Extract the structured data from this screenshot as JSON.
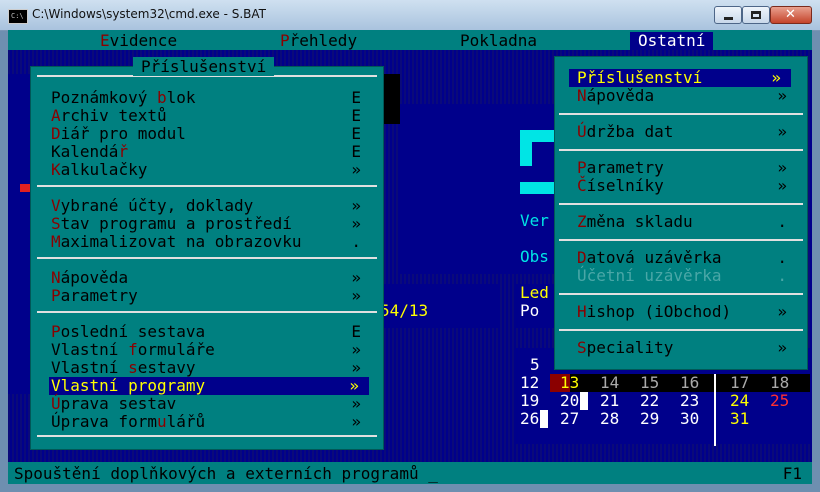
{
  "window": {
    "title": "C:\\Windows\\system32\\cmd.exe - S.BAT",
    "icon_text": "C:\\",
    "icon": "console-icon"
  },
  "menubar": {
    "items": [
      {
        "label": "Evidence",
        "hotkey": "E",
        "rest": "vidence"
      },
      {
        "label": "Přehledy",
        "hotkey": "P",
        "rest": "řehledy"
      },
      {
        "label": "Pokladna",
        "hotkey": "",
        "rest": "Pokladna"
      },
      {
        "label": "Ostatní",
        "hotkey": "",
        "rest": "Ostatní"
      }
    ]
  },
  "main_menu": {
    "title": "Příslušenství",
    "items": [
      {
        "pre": "Poznámkový ",
        "hk": "b",
        "post": "lok",
        "shortcut": "E"
      },
      {
        "pre": "",
        "hk": "A",
        "post": "rchiv textů",
        "shortcut": "E"
      },
      {
        "pre": "",
        "hk": "D",
        "post": "iář pro modul",
        "shortcut": "E"
      },
      {
        "pre": "Kalendá",
        "hk": "ř",
        "post": "",
        "shortcut": "E"
      },
      {
        "pre": "",
        "hk": "K",
        "post": "alkulačky",
        "shortcut": "»"
      },
      {
        "pre": "",
        "hk": "V",
        "post": "ybrané účty, doklady",
        "shortcut": "»"
      },
      {
        "pre": "",
        "hk": "S",
        "post": "tav programu a prostředí",
        "shortcut": "»"
      },
      {
        "pre": "",
        "hk": "M",
        "post": "aximalizovat na obrazovku",
        "shortcut": "."
      },
      {
        "pre": "",
        "hk": "N",
        "post": "ápověda",
        "shortcut": "»"
      },
      {
        "pre": "",
        "hk": "P",
        "post": "arametry",
        "shortcut": "»"
      },
      {
        "pre": "",
        "hk": "P",
        "post": "oslední sestava",
        "shortcut": "E"
      },
      {
        "pre": "Vlastní ",
        "hk": "f",
        "post": "ormuláře",
        "shortcut": "»"
      },
      {
        "pre": "Vlastní ",
        "hk": "s",
        "post": "estavy",
        "shortcut": "»"
      },
      {
        "pre": "",
        "hk": "V",
        "post": "lastní programy",
        "shortcut": "»"
      },
      {
        "pre": "",
        "hk": "Ú",
        "post": "prava sestav",
        "shortcut": "»"
      },
      {
        "pre": "Úprava form",
        "hk": "u",
        "post": "lářů",
        "shortcut": "»"
      }
    ]
  },
  "right_menu": {
    "items": [
      {
        "pre": "",
        "hk": "P",
        "post": "říslušenství",
        "shortcut": "»"
      },
      {
        "pre": "",
        "hk": "N",
        "post": "ápověda",
        "shortcut": "»"
      },
      {
        "pre": "",
        "hk": "Ú",
        "post": "držba dat",
        "shortcut": "»"
      },
      {
        "pre": "",
        "hk": "P",
        "post": "arametry",
        "shortcut": "»"
      },
      {
        "pre": "",
        "hk": "Č",
        "post": "íselníky",
        "shortcut": "»"
      },
      {
        "pre": "",
        "hk": "Z",
        "post": "měna skladu",
        "shortcut": "."
      },
      {
        "pre": "",
        "hk": "D",
        "post": "atová uzávěrka",
        "shortcut": "."
      },
      {
        "pre": "Účetní uzávěrka",
        "hk": "",
        "post": "",
        "shortcut": "."
      },
      {
        "pre": "",
        "hk": "H",
        "post": "ishop (iObchod)",
        "shortcut": "»"
      },
      {
        "pre": "",
        "hk": "S",
        "post": "peciality",
        "shortcut": "»"
      }
    ]
  },
  "background": {
    "ver": "Ver",
    "obs": "Obs",
    "led": "Led",
    "po": "Po",
    "code": "54/13"
  },
  "calendar": {
    "rows": [
      [
        "5"
      ],
      [
        "12",
        "13",
        "14",
        "15",
        "16",
        "17",
        "18"
      ],
      [
        "19",
        "20",
        "21",
        "22",
        "23",
        "24",
        "25"
      ],
      [
        "26",
        "27",
        "28",
        "29",
        "30",
        "31"
      ]
    ]
  },
  "status": {
    "text": "Spouštění doplňkových a externích programů _",
    "key": "F1"
  }
}
